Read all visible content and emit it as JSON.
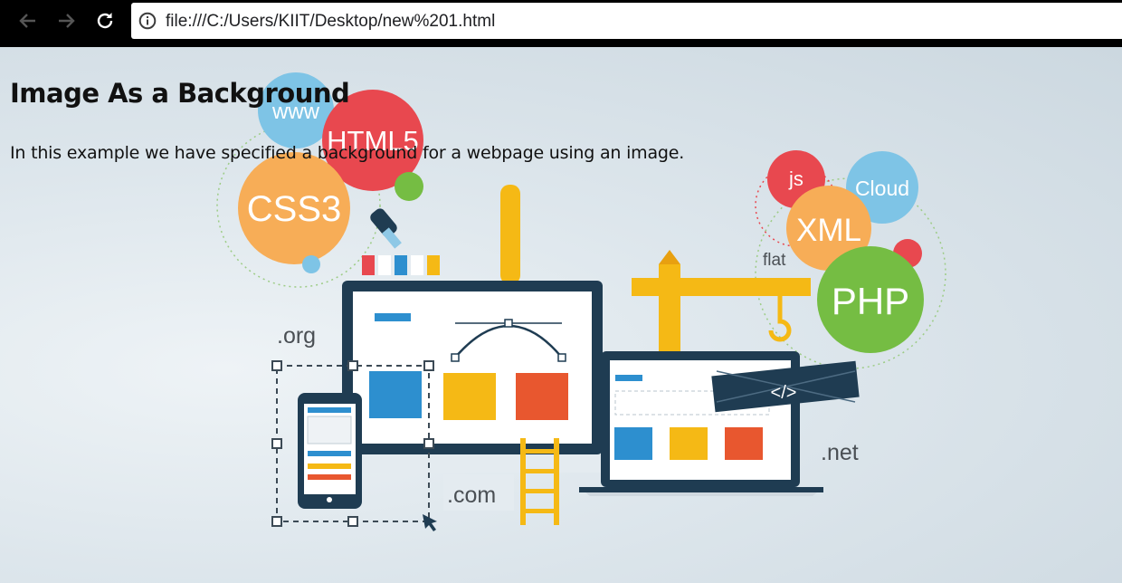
{
  "browser": {
    "url": "file:///C:/Users/KIIT/Desktop/new%201.html",
    "icons": {
      "back": "arrow-left-icon",
      "forward": "arrow-right-icon",
      "reload": "reload-icon",
      "info": "info-icon"
    }
  },
  "page": {
    "title": "Image As a Background",
    "text": "In this example we have specified a background for a webpage using an image."
  },
  "background_image": {
    "labels": {
      "www": "www",
      "html5": "HTML5",
      "css3": "CSS3",
      "js": "js",
      "cloud": "Cloud",
      "xml": "XML",
      "php": "PHP",
      "flat": "flat",
      "org": ".org",
      "net": ".net",
      "com": ".com",
      "code": "</>"
    },
    "colors": {
      "red": "#e8484f",
      "blue": "#7ec4e6",
      "orange": "#f7ad57",
      "green": "#75bd43",
      "navy": "#1f3c52",
      "yellow": "#f5b915"
    }
  }
}
